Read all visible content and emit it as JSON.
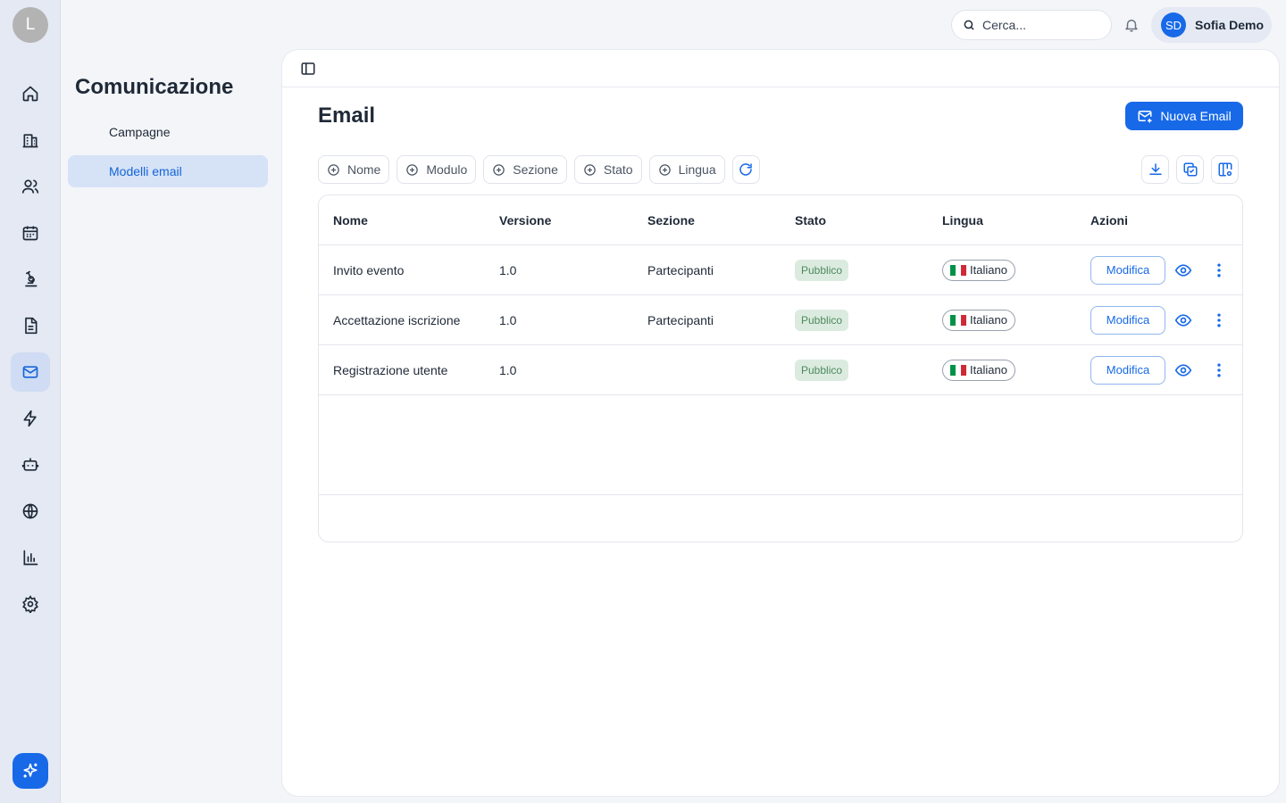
{
  "rail": {
    "avatar_initial": "L",
    "items": [
      {
        "icon": "home-icon"
      },
      {
        "icon": "building-icon"
      },
      {
        "icon": "users-icon"
      },
      {
        "icon": "calendar-icon"
      },
      {
        "icon": "microscope-icon"
      },
      {
        "icon": "document-icon"
      },
      {
        "icon": "mail-icon",
        "active": true
      },
      {
        "icon": "lightning-icon"
      },
      {
        "icon": "bot-icon"
      },
      {
        "icon": "globe-icon"
      },
      {
        "icon": "chart-icon"
      },
      {
        "icon": "gear-icon"
      }
    ],
    "fab_icon": "sparkles-icon"
  },
  "section": {
    "title": "Comunicazione",
    "items": [
      {
        "label": "Campagne"
      },
      {
        "label": "Modelli email",
        "active": true
      }
    ]
  },
  "topbar": {
    "search_placeholder": "Cerca...",
    "user_initials": "SD",
    "user_name": "Sofia Demo"
  },
  "page": {
    "title": "Email",
    "new_button": "Nuova Email"
  },
  "filters": [
    "Nome",
    "Modulo",
    "Sezione",
    "Stato",
    "Lingua"
  ],
  "table": {
    "columns": [
      "Nome",
      "Versione",
      "Sezione",
      "Stato",
      "Lingua",
      "Azioni"
    ],
    "rows": [
      {
        "name": "Invito evento",
        "version": "1.0",
        "section": "Partecipanti",
        "state": "Pubblico",
        "language": "Italiano",
        "action": "Modifica"
      },
      {
        "name": "Accettazione iscrizione",
        "version": "1.0",
        "section": "Partecipanti",
        "state": "Pubblico",
        "language": "Italiano",
        "action": "Modifica"
      },
      {
        "name": "Registrazione utente",
        "version": "1.0",
        "section": "",
        "state": "Pubblico",
        "language": "Italiano",
        "action": "Modifica"
      }
    ]
  },
  "colors": {
    "accent": "#1769e8",
    "badge_bg": "#dcebe0",
    "badge_text": "#4d8a5e",
    "flag": [
      "#009246",
      "#ffffff",
      "#ce2b37"
    ]
  }
}
